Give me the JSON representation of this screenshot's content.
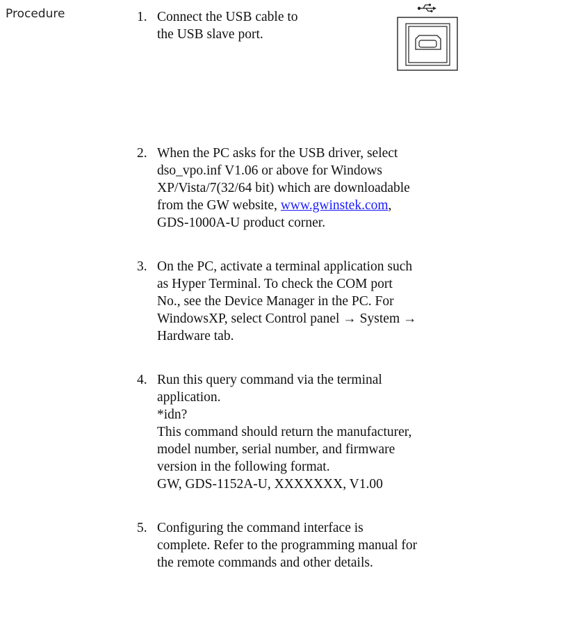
{
  "section_label": "Procedure",
  "steps": [
    {
      "number": "1.",
      "lines": [
        "Connect the USB cable to",
        "the USB slave port."
      ]
    },
    {
      "number": "2.",
      "lines": [
        "When the PC asks for the USB driver, select",
        "dso_vpo.inf V1.06 or above for Windows",
        "XP/Vista/7(32/64 bit) which are downloadable"
      ],
      "line4_prefix": "from the GW website, ",
      "link_text": "www.gwinstek.com",
      "line4_suffix": ",",
      "line5": "GDS-1000A-U product corner."
    },
    {
      "number": "3.",
      "lines": [
        "On the PC, activate a terminal application such",
        "as Hyper Terminal. To check the COM port",
        "No., see the Device Manager in the PC. For",
        "WindowsXP, select Control panel → System →",
        "Hardware tab."
      ]
    },
    {
      "number": "4.",
      "lines": [
        "Run this query command via the terminal",
        "application.",
        "*idn?",
        "This command should return the manufacturer,",
        "model number, serial number, and firmware",
        "version in the following format.",
        "GW, GDS-1152A-U, XXXXXXX, V1.00"
      ]
    },
    {
      "number": "5.",
      "lines": [
        "Configuring the command interface is",
        "complete. Refer to the programming manual for",
        "the remote commands and other details."
      ]
    }
  ],
  "usb_icon": "usb-symbol-icon",
  "usb_port_icon": "usb-type-b-port-icon"
}
